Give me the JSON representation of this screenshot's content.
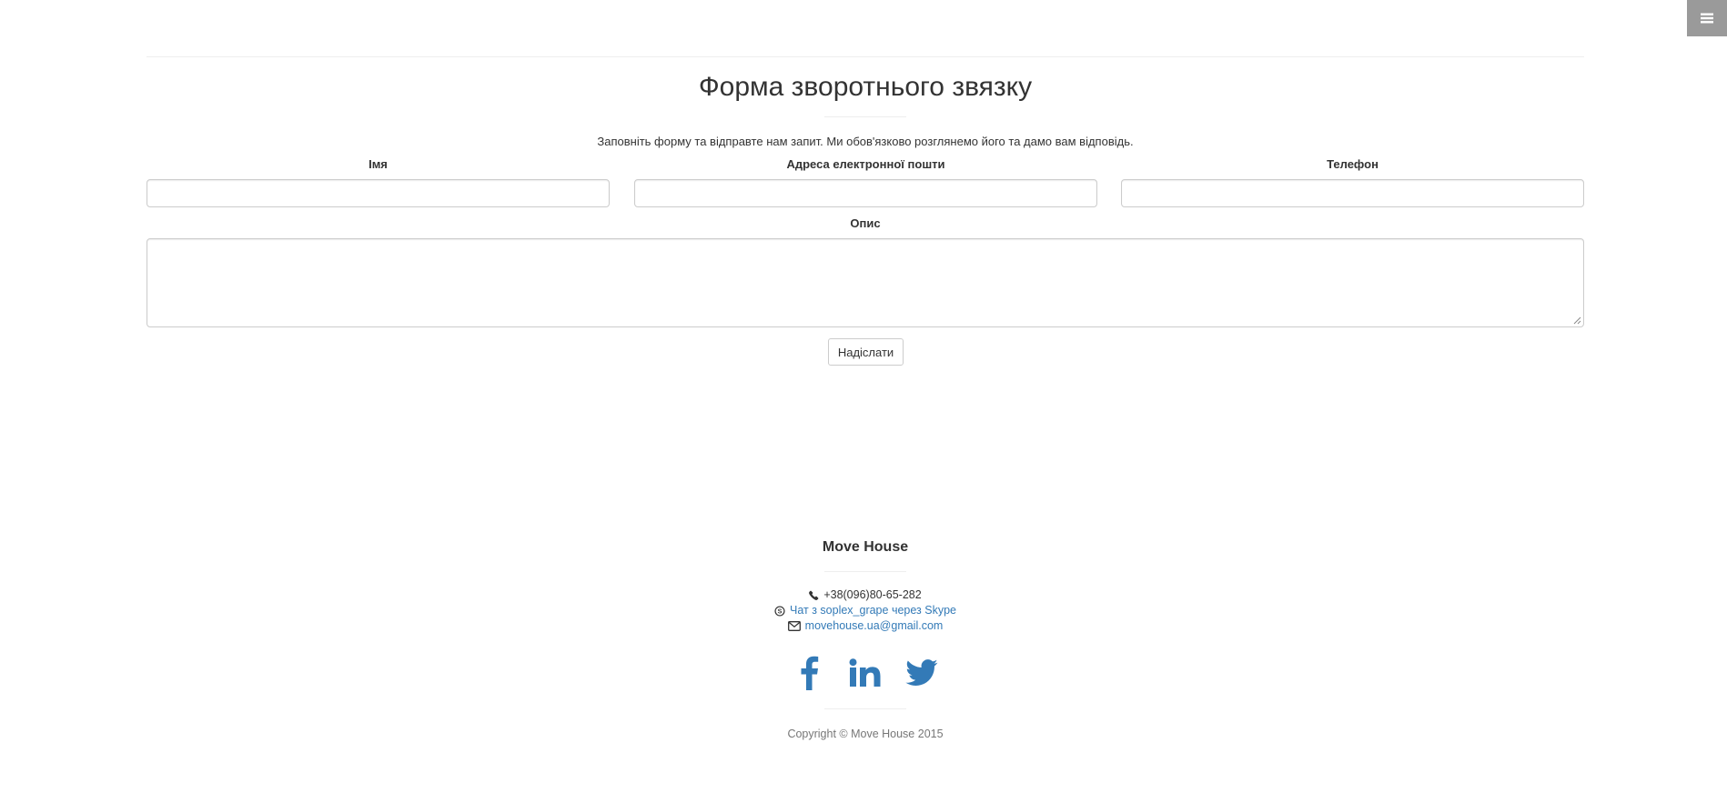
{
  "menu": {
    "icon": "hamburger-icon"
  },
  "contact_form": {
    "title": "Форма зворотнього звязку",
    "intro": "Заповніть форму та відправте нам запит. Ми обов'язково розглянемо його та дамо вам відповідь.",
    "fields": [
      {
        "label": "Імя",
        "value": "",
        "placeholder": ""
      },
      {
        "label": "Адреса електронної пошти",
        "value": "",
        "placeholder": ""
      },
      {
        "label": "Телефон",
        "value": "",
        "placeholder": ""
      }
    ],
    "description": {
      "label": "Опис",
      "value": ""
    },
    "submit_label": "Надіслати"
  },
  "footer": {
    "brand": "Move House",
    "phone": {
      "icon": "phone-icon",
      "text": "+38(096)80-65-282"
    },
    "skype": {
      "icon": "skype-icon",
      "text": "Чат з soplex_grape через Skype"
    },
    "email": {
      "icon": "envelope-icon",
      "text": "movehouse.ua@gmail.com"
    },
    "social": [
      {
        "name": "facebook",
        "icon": "facebook-icon"
      },
      {
        "name": "linkedin",
        "icon": "linkedin-icon"
      },
      {
        "name": "twitter",
        "icon": "twitter-icon"
      }
    ],
    "copyright": "Copyright © Move House 2015"
  },
  "colors": {
    "link": "#337ab7",
    "menu_bg": "#9a9a9a",
    "border": "#cccccc",
    "muted": "#777777"
  }
}
